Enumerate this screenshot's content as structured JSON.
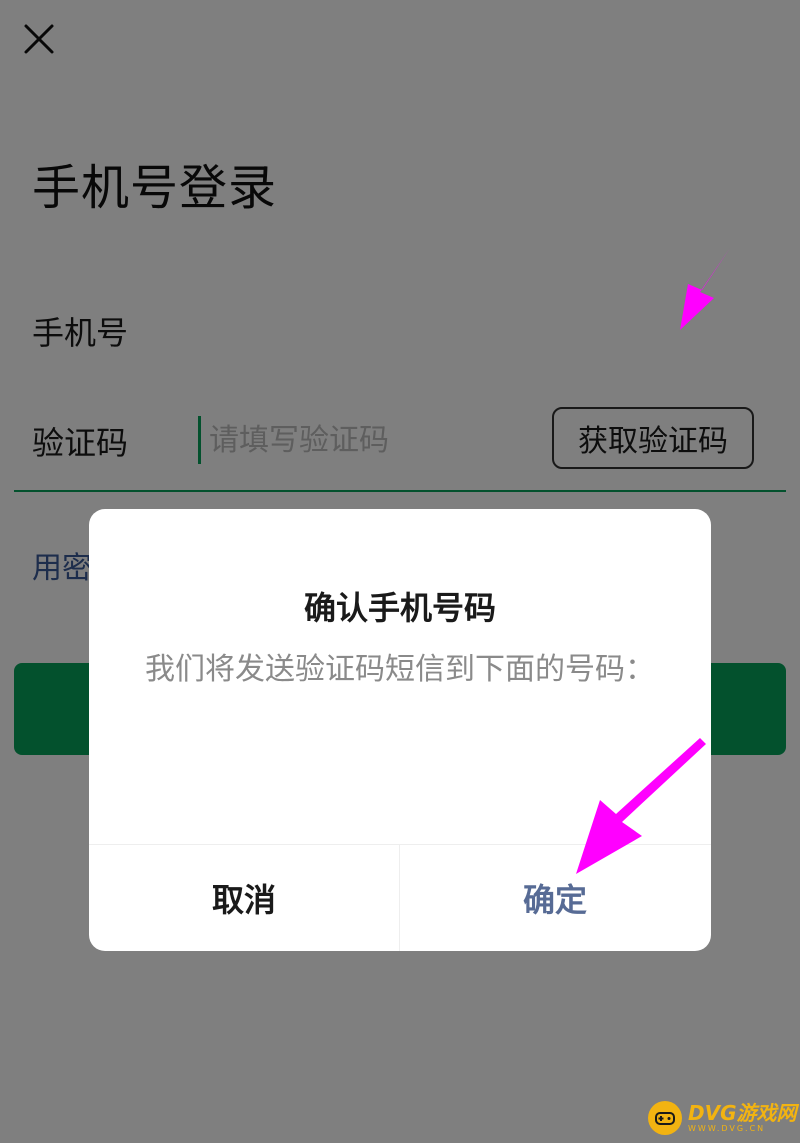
{
  "login_page": {
    "title": "手机号登录",
    "phone_label": "手机号",
    "phone_value": "",
    "code_label": "验证码",
    "code_placeholder": "请填写验证码",
    "get_code_label": "获取验证码",
    "password_login_link": "用密",
    "close_icon": "close-icon",
    "accent_color": "#07a35a"
  },
  "dialog": {
    "title": "确认手机号码",
    "message": "我们将发送验证码短信到下面的号码：",
    "phone_number": "",
    "cancel_label": "取消",
    "confirm_label": "确定",
    "confirm_color": "#576b95"
  },
  "annotations": {
    "arrow_color": "#ff00ff"
  },
  "watermark": {
    "text": "DVG游戏网",
    "subtext": "WWW.DVG.CN"
  }
}
